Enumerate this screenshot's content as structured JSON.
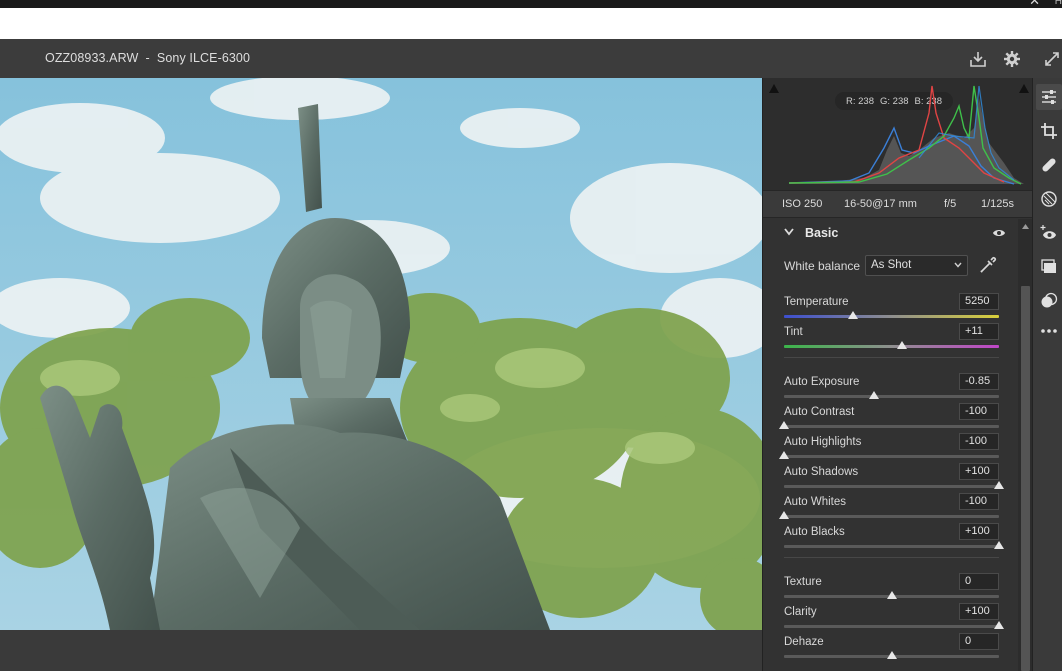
{
  "os": {
    "close_glyph": "✕",
    "help_glyph": "H"
  },
  "header": {
    "title": "OZZ08933.ARW  -  Sony ILCE-6300",
    "icons": [
      "save-icon",
      "gear-icon",
      "fullscreen-icon"
    ]
  },
  "histogram": {
    "readout_r": "R: 238",
    "readout_g": "G: 238",
    "readout_b": "B: 238"
  },
  "exif": {
    "iso": "ISO 250",
    "lens": "16-50@17 mm",
    "aperture": "f/5",
    "shutter": "1/125s"
  },
  "basic": {
    "title": "Basic",
    "white_balance_label": "White balance",
    "white_balance_value": "As Shot",
    "sliders": [
      {
        "label": "Temperature",
        "value": "5250",
        "position": 0.32
      },
      {
        "label": "Tint",
        "value": "+11",
        "position": 0.55
      },
      {
        "label": "Auto Exposure",
        "value": "-0.85",
        "position": 0.42
      },
      {
        "label": "Auto Contrast",
        "value": "-100",
        "position": 0.0
      },
      {
        "label": "Auto Highlights",
        "value": "-100",
        "position": 0.0
      },
      {
        "label": "Auto Shadows",
        "value": "+100",
        "position": 1.0
      },
      {
        "label": "Auto Whites",
        "value": "-100",
        "position": 0.0
      },
      {
        "label": "Auto Blacks",
        "value": "+100",
        "position": 1.0
      },
      {
        "label": "Texture",
        "value": "0",
        "position": 0.5
      },
      {
        "label": "Clarity",
        "value": "+100",
        "position": 1.0
      },
      {
        "label": "Dehaze",
        "value": "0",
        "position": 0.5
      }
    ]
  },
  "tools": [
    "edit-sliders-icon",
    "crop-icon",
    "healing-icon",
    "mask-icon",
    "redeye-icon",
    "snapshots-icon",
    "presets-icon",
    "more-icon"
  ],
  "colors": {
    "panel_bg": "#323232",
    "header_bg": "#3c3c3c",
    "sky": "#8ec4dc",
    "foliage": "#7aa04a",
    "statue": "#5e6f67"
  }
}
